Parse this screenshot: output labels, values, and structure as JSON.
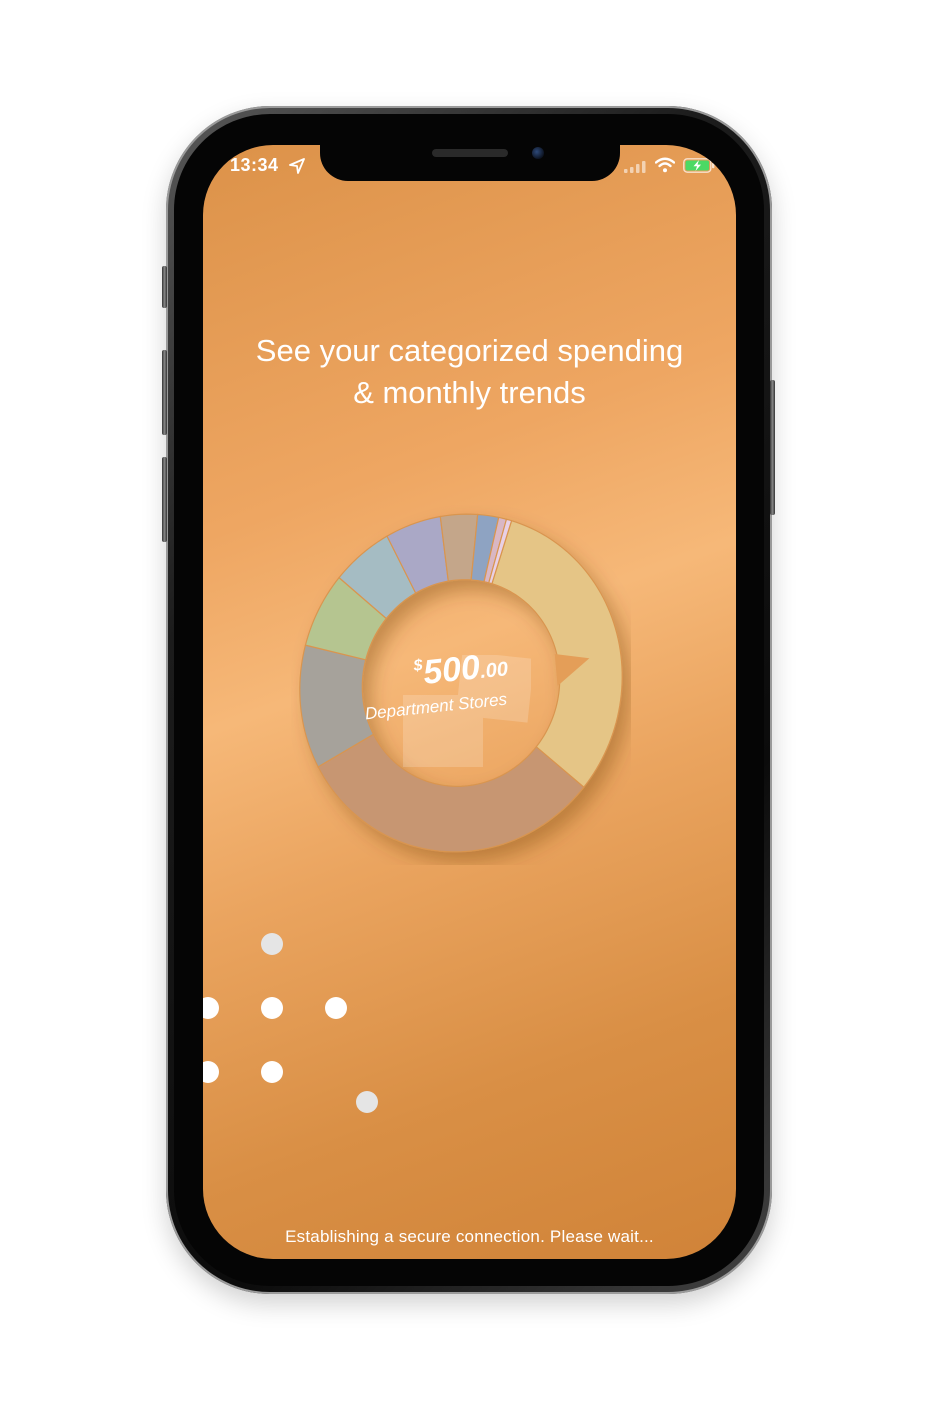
{
  "status_bar": {
    "time": "13:34",
    "icons": [
      "location-arrow-icon",
      "cellular-signal-icon",
      "wifi-icon",
      "battery-charging-icon"
    ]
  },
  "onboarding": {
    "headline_line1": "See your categorized spending",
    "headline_line2": "& monthly trends"
  },
  "chart_data": {
    "type": "pie",
    "selected_amount_symbol": "$",
    "selected_amount_whole": "500",
    "selected_amount_cents": ".00",
    "selected_category": "Department Stores",
    "slices": [
      {
        "value": 118,
        "color": "#e5c586"
      },
      {
        "value": 118,
        "color": "#c79672"
      },
      {
        "value": 45,
        "color": "#a6a29b"
      },
      {
        "value": 27,
        "color": "#b5c590"
      },
      {
        "value": 23,
        "color": "#a5bcc3"
      },
      {
        "value": 21,
        "color": "#aaa8c6"
      },
      {
        "value": 14,
        "color": "#c4a68a"
      },
      {
        "value": 8,
        "color": "#8ea3c2"
      },
      {
        "value": 3,
        "color": "#d9b7c4"
      },
      {
        "value": 2,
        "color": "#e8d0e5"
      }
    ]
  },
  "loading": {
    "message": "Establishing a secure connection. Please wait..."
  },
  "colors": {
    "background_start": "#dc9249",
    "background_highlight": "#f6b878",
    "background_end": "#d08338",
    "text": "#ffffff"
  }
}
